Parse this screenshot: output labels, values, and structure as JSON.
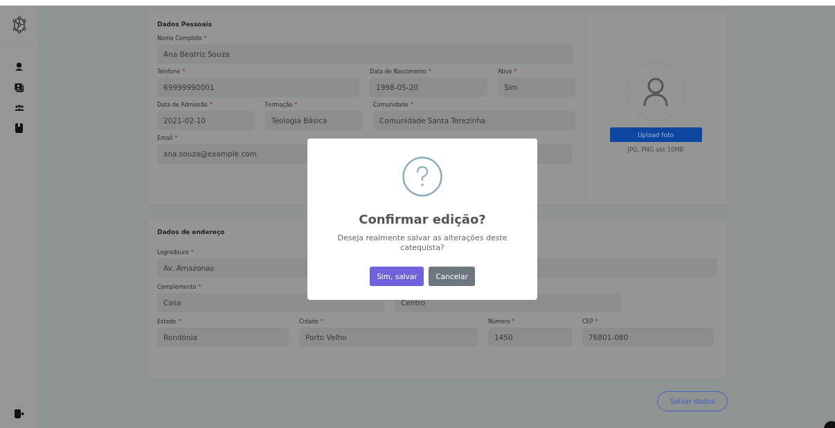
{
  "personal": {
    "title": "Dados Pessoais",
    "fields": [
      {
        "label": "Nome Completo",
        "mark": "*",
        "value": "Ana Beatriz Souza"
      },
      {
        "label": "Telefone",
        "mark": "*",
        "value": "69999990001"
      },
      {
        "label": "Data de Nascimento",
        "mark": "*",
        "value": "1998-05-20"
      },
      {
        "label": "Ativo",
        "mark": "*",
        "value": "Sim"
      },
      {
        "label": "Data de Admissão",
        "mark": "*",
        "value": "2021-02-10"
      },
      {
        "label": "Formação",
        "mark": "*",
        "value": "Teologia Básica"
      },
      {
        "label": "Comunidade",
        "mark": "*",
        "value": "Comunidade Santa Terezinha"
      },
      {
        "label": "Email",
        "mark": "*",
        "value": "ana.souza@example.com"
      }
    ],
    "photo": {
      "button": "Upload foto",
      "hint": "JPG, PNG até 10MB"
    }
  },
  "address": {
    "title": "Dados de endereço",
    "fields": [
      {
        "label": "Logradouro",
        "mark": "*",
        "value": "Av. Amazonas"
      },
      {
        "label": "Complemento",
        "mark": "*",
        "value": "Casa"
      },
      {
        "value": "Centro"
      },
      {
        "label": "Estado",
        "mark": "*",
        "value": "Rondônia"
      },
      {
        "label": "Cidade",
        "mark": "*",
        "value": "Porto Velho"
      },
      {
        "label": "Número",
        "mark": "*",
        "value": "1450"
      },
      {
        "label": "CEP",
        "mark": "*",
        "value": "76801-080"
      }
    ]
  },
  "save_button": "Salvar dados",
  "dialog": {
    "title": "Confirmar edição?",
    "text": "Deseja realmente salvar as alterações deste catequista?",
    "confirm": "Sim, salvar",
    "cancel": "Cancelar"
  }
}
